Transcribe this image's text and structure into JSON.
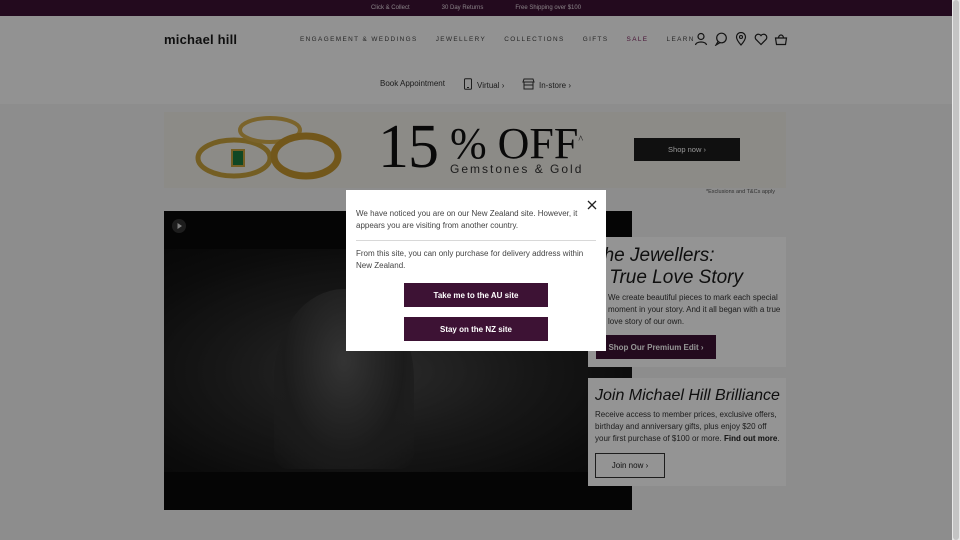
{
  "promo_bar": {
    "items": [
      "Click & Collect",
      "30 Day Returns",
      "Free Shipping over $100"
    ]
  },
  "header": {
    "logo": "michael hill",
    "nav": [
      "ENGAGEMENT & WEDDINGS",
      "JEWELLERY",
      "COLLECTIONS",
      "GIFTS",
      "SALE",
      "LEARN"
    ],
    "icons": [
      "account-icon",
      "chat-icon",
      "location-icon",
      "heart-icon",
      "bag-icon"
    ]
  },
  "subnav": {
    "book": "Book Appointment",
    "virtual": "Virtual ›",
    "instore": "In-store ›"
  },
  "banner": {
    "percent": "15",
    "off": "% OFF",
    "caret": "^",
    "subtitle": "Gemstones & Gold",
    "cta": "Shop now ›",
    "note": "*Exclusions and T&Cs apply"
  },
  "card1": {
    "title_line1": "The Jewellers:",
    "title_line2": "A True Love Story",
    "body": "We create beautiful pieces to mark each special moment in your story. And it all began with a true love story of our own.",
    "cta": "Shop Our Premium Edit ›"
  },
  "card2": {
    "title": "Join Michael Hill Brilliance",
    "body": "Receive access to member prices, exclusive offers, birthday and anniversary gifts, plus enjoy $20 off your first purchase of $100 or more.",
    "link": "Find out more",
    "cta": "Join now ›"
  },
  "modal": {
    "text1": "We have noticed you are on our New Zealand site. However, it appears you are visiting from another country.",
    "text2": "From this site, you can only purchase for delivery address within New Zealand.",
    "btn_au": "Take me to the AU site",
    "btn_nz": "Stay on the NZ site"
  },
  "colors": {
    "brand": "#3d1234",
    "sale": "#7a1c5a"
  }
}
